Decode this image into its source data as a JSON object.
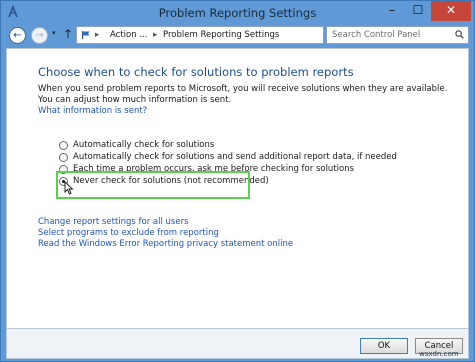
{
  "window": {
    "title": "Problem Reporting Settings",
    "minimize_glyph": "–",
    "maximize_glyph": "☐",
    "close_glyph": "✕"
  },
  "nav": {
    "back_glyph": "←",
    "forward_glyph": "→",
    "up_glyph": "↑",
    "breadcrumb": [
      "Action ...",
      "Problem Reporting Settings"
    ],
    "separator": "▸",
    "dropdown_glyph": "▾",
    "refresh_glyph": "↻"
  },
  "search": {
    "placeholder": "Search Control Panel"
  },
  "main": {
    "heading": "Choose when to check for solutions to problem reports",
    "description": "When you send problem reports to Microsoft, you will receive solutions when they are available. You can adjust how much information is sent.",
    "info_link": "What information is sent?",
    "options": [
      {
        "label": "Automatically check for solutions",
        "checked": false
      },
      {
        "label": "Automatically check for solutions and send additional report data, if needed",
        "checked": false
      },
      {
        "label": "Each time a problem occurs, ask me before checking for solutions",
        "checked": false
      },
      {
        "label": "Never check for solutions (not recommended)",
        "checked": true
      }
    ],
    "links": [
      "Change report settings for all users",
      "Select programs to exclude from reporting",
      "Read the Windows Error Reporting privacy statement online"
    ]
  },
  "footer": {
    "ok_label": "OK",
    "cancel_label": "Cancel"
  },
  "watermark": "wsxdn.com",
  "colors": {
    "accent": "#1e4f8f",
    "link": "#1f54c4",
    "highlight": "#58d14b",
    "close_button": "#c7463a"
  },
  "icons": {
    "app": "control-panel-flag-icon",
    "address": "control-panel-flag-icon",
    "search": "magnifier-icon",
    "cursor": "mouse-pointer-icon"
  }
}
